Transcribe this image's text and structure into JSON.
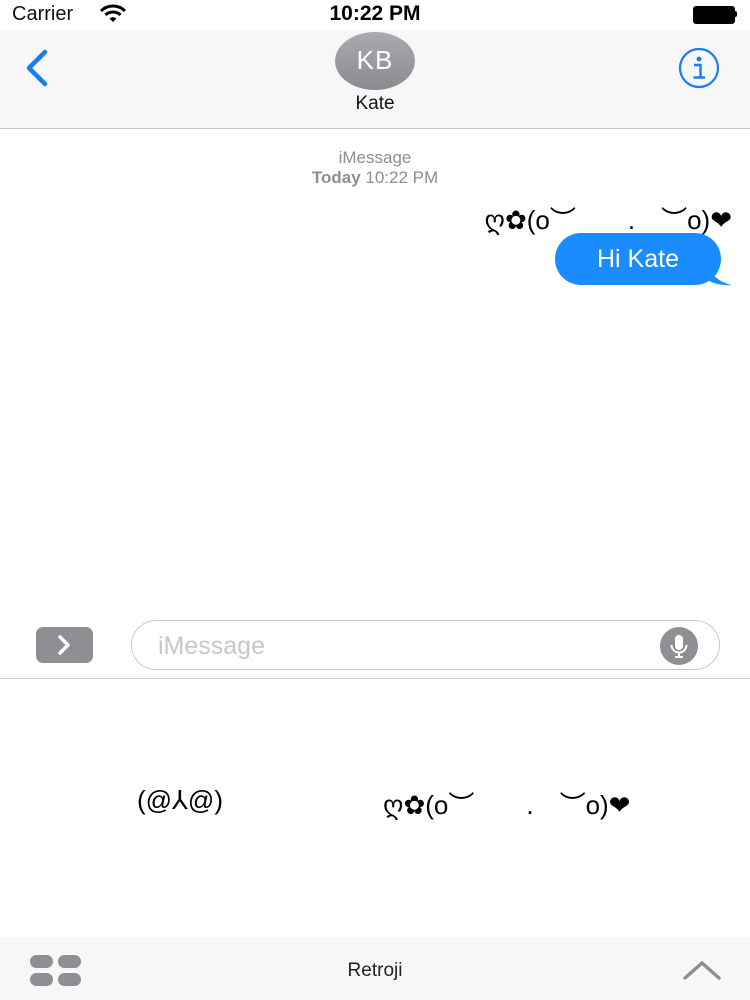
{
  "status_bar": {
    "carrier": "Carrier",
    "time": "10:22 PM"
  },
  "header": {
    "avatar_initials": "KB",
    "contact_name": "Kate",
    "accent_color": "#1a7cf2"
  },
  "conversation": {
    "service": "iMessage",
    "timestamp_day": "Today",
    "timestamp_time": "10:22 PM",
    "sent_sticker": "ღ✿(o︶　　.　︶o)❤",
    "sent_message": "Hi Kate",
    "bubble_color": "#1a8cff"
  },
  "input_bar": {
    "placeholder": "iMessage"
  },
  "drawer": {
    "stickers": [
      "(@⅄@)",
      "ღ✿(o︶　　.　︶o)❤"
    ]
  },
  "bottom_bar": {
    "app_name": "Retroji"
  },
  "icons": [
    "wifi-icon",
    "battery-icon",
    "back-chevron-icon",
    "info-icon",
    "chevron-right-icon",
    "microphone-icon",
    "app-grid-icon",
    "chevron-up-icon"
  ]
}
